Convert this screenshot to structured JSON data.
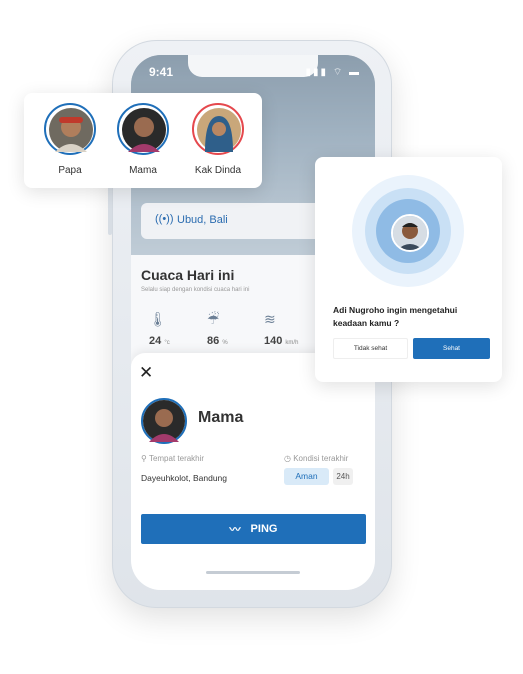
{
  "status_bar": {
    "time": "9:41",
    "icons": "▮▮▮ ⌔ ▬"
  },
  "location": {
    "icon": "((•))",
    "name": "Ubud, Bali"
  },
  "weather": {
    "title": "Cuaca Hari ini",
    "subtitle": "Selalu siap dengan kondisi cuaca hari ini",
    "items": [
      {
        "icon": "thermometer-icon",
        "glyph": "🌡",
        "value": "24",
        "unit": "°c"
      },
      {
        "icon": "rain-icon",
        "glyph": "☔",
        "value": "86",
        "unit": "%"
      },
      {
        "icon": "wind-icon",
        "glyph": "≋",
        "value": "140",
        "unit": "km/h"
      }
    ]
  },
  "sheet": {
    "close_glyph": "✕",
    "name": "Mama",
    "place_label": "Tempat terakhir",
    "place_value": "Dayeuhkolot, Bandung",
    "condition_label": "Kondisi terakhir",
    "condition_value": "Aman",
    "condition_time": "24h",
    "ping_label": "PING"
  },
  "family": {
    "members": [
      {
        "name": "Papa",
        "ring": "#1f6fb9"
      },
      {
        "name": "Mama",
        "ring": "#1f6fb9"
      },
      {
        "name": "Kak Dinda",
        "ring": "#e5484d"
      }
    ]
  },
  "notification": {
    "message": "Adi Nugroho ingin mengetahui keadaan kamu ?",
    "decline_label": "Tidak sehat",
    "accept_label": "Sehat"
  }
}
